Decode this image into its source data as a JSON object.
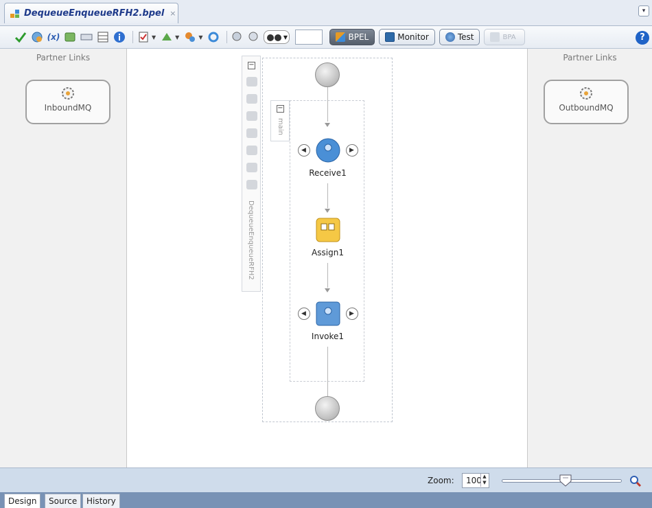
{
  "tab": {
    "title": "DequeueEnqueueRFH2.bpel",
    "close_glyph": "×",
    "menu_glyph": "▾"
  },
  "toolbar": {
    "modes": [
      {
        "label": "BPEL",
        "state": "active",
        "icon": "bpel-icon"
      },
      {
        "label": "Monitor",
        "state": "normal",
        "icon": "monitor-icon"
      },
      {
        "label": "Test",
        "state": "normal",
        "icon": "test-icon"
      },
      {
        "label": "BPA",
        "state": "disabled",
        "icon": "bpa-icon"
      }
    ],
    "help_glyph": "?"
  },
  "partner_links": {
    "left_title": "Partner Links",
    "right_title": "Partner Links",
    "inbound": "InboundMQ",
    "outbound": "OutboundMQ"
  },
  "process": {
    "name": "DequeueEnqueueRFH2",
    "scope": "main",
    "activities": {
      "receive": "Receive1",
      "assign": "Assign1",
      "invoke": "Invoke1"
    }
  },
  "zoom": {
    "label": "Zoom:",
    "value": "100",
    "level_percent": 100
  },
  "bottom_tabs": {
    "design": "Design",
    "source": "Source",
    "history": "History"
  },
  "colors": {
    "receive_blue": "#4a8fd6",
    "assign_yellow": "#f5c845",
    "invoke_blue": "#5f9ad8",
    "accent": "#1f63c7"
  }
}
